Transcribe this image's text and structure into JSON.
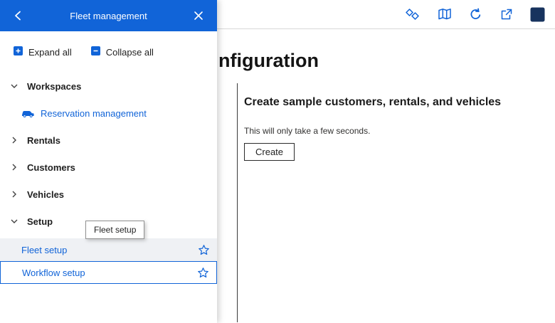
{
  "sidebar": {
    "header": {
      "title": "Fleet management"
    },
    "toolbar": {
      "expand_all": "Expand all",
      "collapse_all": "Collapse all"
    },
    "tree": [
      {
        "label": "Workspaces",
        "expanded": true
      },
      {
        "label": "Reservation management"
      },
      {
        "label": "Rentals",
        "expanded": false
      },
      {
        "label": "Customers",
        "expanded": false
      },
      {
        "label": "Vehicles",
        "expanded": false
      },
      {
        "label": "Setup",
        "expanded": true
      },
      {
        "label": "Fleet setup",
        "starred": true,
        "selected": true
      },
      {
        "label": "Workflow setup",
        "starred": true,
        "focused": true
      }
    ],
    "tooltip": "Fleet setup"
  },
  "topbar": {
    "icons": [
      "copilot-diamonds-icon",
      "guide-book-icon",
      "refresh-icon",
      "open-in-new-window-icon",
      "dark-app-square-icon"
    ]
  },
  "main": {
    "page_title_visible": "nfiguration",
    "section": {
      "heading": "Create sample customers, rentals, and vehicles",
      "note": "This will only take a few seconds.",
      "create_button": "Create"
    }
  },
  "colors": {
    "header_blue": "#1164D8",
    "link_blue": "#1164D8",
    "selected_row_bg": "#EFF1F4",
    "focus_border": "#1164D8",
    "dark_square": "#17335E"
  }
}
